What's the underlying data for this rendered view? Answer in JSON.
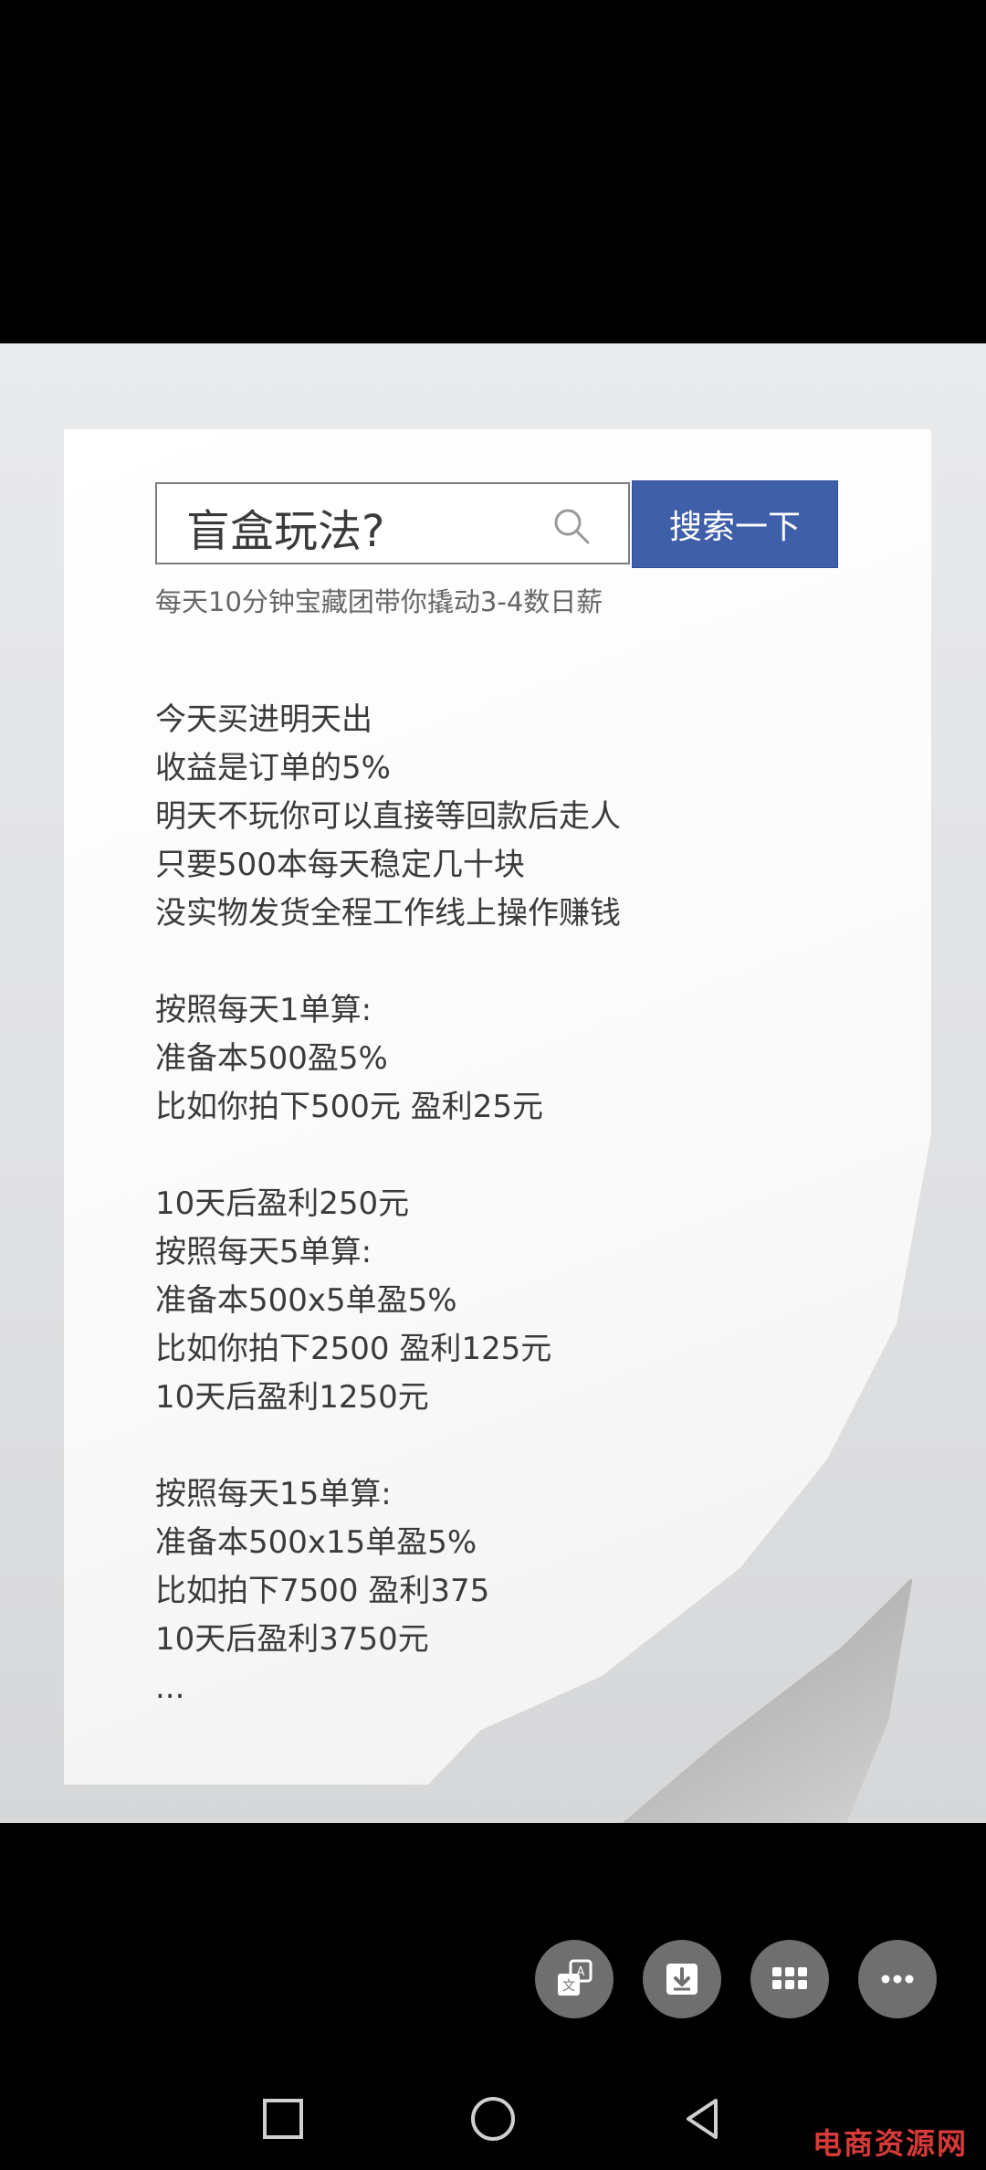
{
  "search": {
    "query": "盲盒玩法?",
    "button_label": "搜索一下",
    "subtitle": "每天10分钟宝藏团带你撬动3-4数日薪"
  },
  "content_lines": [
    "今天买进明天出",
    "收益是订单的5%",
    "明天不玩你可以直接等回款后走人",
    "只要500本每天稳定几十块",
    "没实物发货全程工作线上操作赚钱",
    "",
    "按照每天1单算:",
    "准备本500盈5%",
    "比如你拍下500元 盈利25元",
    "",
    "10天后盈利250元",
    "按照每天5单算:",
    "准备本500x5单盈5%",
    "比如你拍下2500 盈利125元",
    "10天后盈利1250元",
    "",
    "按照每天15单算:",
    "准备本500x15单盈5%",
    "比如拍下7500 盈利375",
    "10天后盈利3750元",
    "..."
  ],
  "toolbar": {
    "translate_icon": "translate-icon",
    "download_icon": "download-icon",
    "grid_icon": "grid-icon",
    "more_icon": "more-icon"
  },
  "navbar": {
    "recents_icon": "square-icon",
    "home_icon": "circle-icon",
    "back_icon": "triangle-back-icon"
  },
  "watermark": "电商资源网"
}
